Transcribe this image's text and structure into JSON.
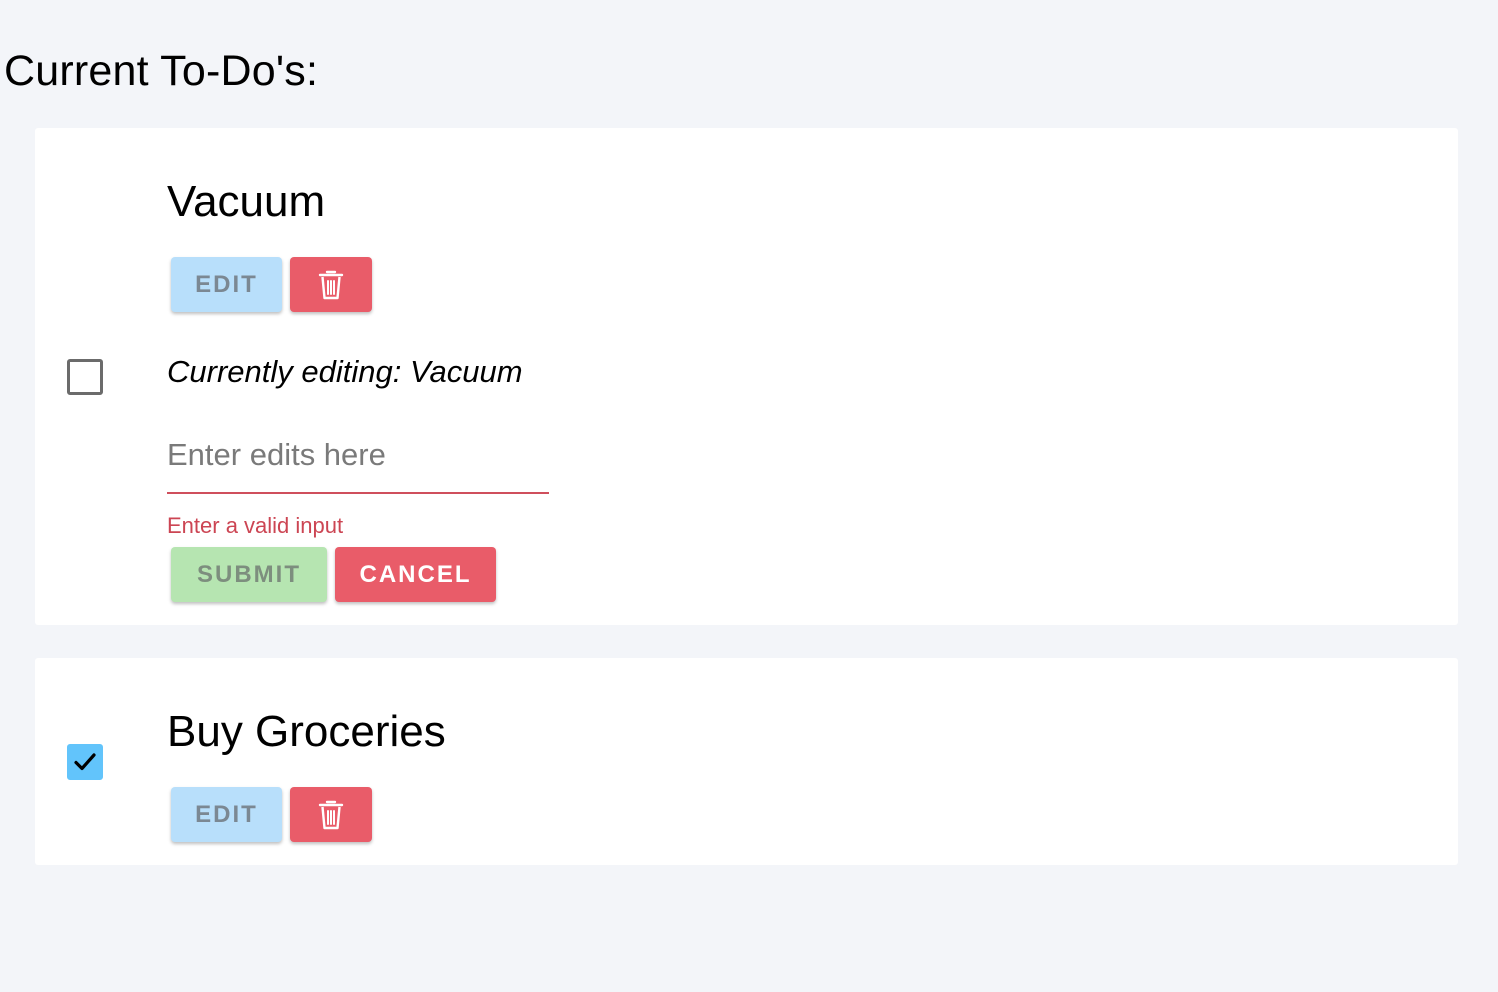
{
  "page": {
    "title": "Current To-Do's:"
  },
  "todos": [
    {
      "title": "Vacuum",
      "checked": false,
      "edit_label": "EDIT",
      "delete_icon": "trash-icon",
      "editing": {
        "label": "Currently editing: Vacuum",
        "input_value": "",
        "input_placeholder": "Enter edits here",
        "error": "Enter a valid input",
        "submit_label": "SUBMIT",
        "cancel_label": "CANCEL"
      }
    },
    {
      "title": "Buy Groceries",
      "checked": true,
      "edit_label": "EDIT",
      "delete_icon": "trash-icon"
    }
  ],
  "colors": {
    "background": "#f3f5f9",
    "card": "#ffffff",
    "edit_button": "#b8dffb",
    "delete_button": "#e95c69",
    "submit_button": "#b6e5b1",
    "cancel_button": "#e95c69",
    "checkbox_checked": "#62c4fb",
    "error": "#cc4553"
  }
}
